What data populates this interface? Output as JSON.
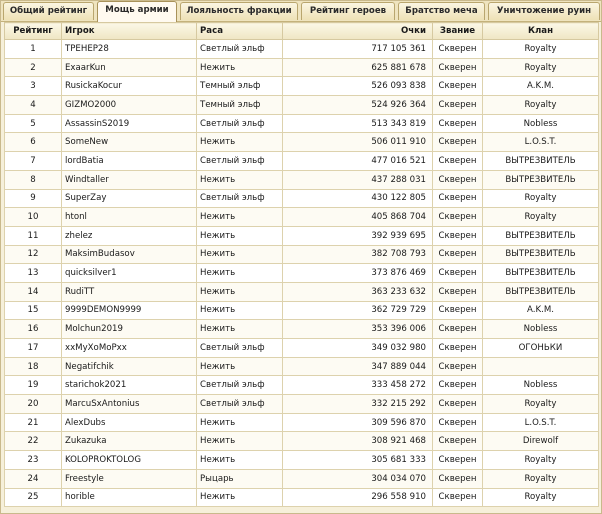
{
  "tabs": [
    {
      "label": "Общий рейтинг",
      "active": false
    },
    {
      "label": "Мощь армии",
      "active": true
    },
    {
      "label": "Лояльность фракции",
      "active": false
    },
    {
      "label": "Рейтинг героев",
      "active": false
    },
    {
      "label": "Братство меча",
      "active": false
    },
    {
      "label": "Уничтожение руин",
      "active": false
    }
  ],
  "table": {
    "headers": {
      "rank": "Рейтинг",
      "player": "Игрок",
      "race": "Раса",
      "points": "Очки",
      "title": "Звание",
      "clan": "Клан"
    },
    "rows": [
      {
        "rank": "1",
        "player": "ТРЕНЕР28",
        "race": "Светлый эльф",
        "points": "717 105 361",
        "title": "Скверен",
        "clan": "Royalty"
      },
      {
        "rank": "2",
        "player": "ExaarKun",
        "race": "Нежить",
        "points": "625 881 678",
        "title": "Скверен",
        "clan": "Royalty"
      },
      {
        "rank": "3",
        "player": "RusickaKocur",
        "race": "Темный эльф",
        "points": "526 093 838",
        "title": "Скверен",
        "clan": "A.K.M."
      },
      {
        "rank": "4",
        "player": "GIZMO2000",
        "race": "Темный эльф",
        "points": "524 926 364",
        "title": "Скверен",
        "clan": "Royalty"
      },
      {
        "rank": "5",
        "player": "AssassinS2019",
        "race": "Светлый эльф",
        "points": "513 343 819",
        "title": "Скверен",
        "clan": "Nobless"
      },
      {
        "rank": "6",
        "player": "SomeNew",
        "race": "Нежить",
        "points": "506 011 910",
        "title": "Скверен",
        "clan": "L.O.S.T."
      },
      {
        "rank": "7",
        "player": "lordBatia",
        "race": "Светлый эльф",
        "points": "477 016 521",
        "title": "Скверен",
        "clan": "ВЫТРЕЗВИТЕЛЬ"
      },
      {
        "rank": "8",
        "player": "Windtaller",
        "race": "Нежить",
        "points": "437 288 031",
        "title": "Скверен",
        "clan": "ВЫТРЕЗВИТЕЛЬ"
      },
      {
        "rank": "9",
        "player": "SuperZay",
        "race": "Светлый эльф",
        "points": "430 122 805",
        "title": "Скверен",
        "clan": "Royalty"
      },
      {
        "rank": "10",
        "player": "htonl",
        "race": "Нежить",
        "points": "405 868 704",
        "title": "Скверен",
        "clan": "Royalty"
      },
      {
        "rank": "11",
        "player": "zhelez",
        "race": "Нежить",
        "points": "392 939 695",
        "title": "Скверен",
        "clan": "ВЫТРЕЗВИТЕЛЬ"
      },
      {
        "rank": "12",
        "player": "MaksimBudasov",
        "race": "Нежить",
        "points": "382 708 793",
        "title": "Скверен",
        "clan": "ВЫТРЕЗВИТЕЛЬ"
      },
      {
        "rank": "13",
        "player": "quicksilver1",
        "race": "Нежить",
        "points": "373 876 469",
        "title": "Скверен",
        "clan": "ВЫТРЕЗВИТЕЛЬ"
      },
      {
        "rank": "14",
        "player": "RudiTT",
        "race": "Нежить",
        "points": "363 233 632",
        "title": "Скверен",
        "clan": "ВЫТРЕЗВИТЕЛЬ"
      },
      {
        "rank": "15",
        "player": "9999DEMON9999",
        "race": "Нежить",
        "points": "362 729 729",
        "title": "Скверен",
        "clan": "A.K.M."
      },
      {
        "rank": "16",
        "player": "Molchun2019",
        "race": "Нежить",
        "points": "353 396 006",
        "title": "Скверен",
        "clan": "Nobless"
      },
      {
        "rank": "17",
        "player": "xxMyXoMoPxx",
        "race": "Светлый эльф",
        "points": "349 032 980",
        "title": "Скверен",
        "clan": "ОГОНЬКИ"
      },
      {
        "rank": "18",
        "player": "Negatifchik",
        "race": "Нежить",
        "points": "347 889 044",
        "title": "Скверен",
        "clan": ""
      },
      {
        "rank": "19",
        "player": "starichok2021",
        "race": "Светлый эльф",
        "points": "333 458 272",
        "title": "Скверен",
        "clan": "Nobless"
      },
      {
        "rank": "20",
        "player": "MarcuSxAntonius",
        "race": "Светлый эльф",
        "points": "332 215 292",
        "title": "Скверен",
        "clan": "Royalty"
      },
      {
        "rank": "21",
        "player": "AlexDubs",
        "race": "Нежить",
        "points": "309 596 870",
        "title": "Скверен",
        "clan": "L.O.S.T."
      },
      {
        "rank": "22",
        "player": "Zukazuka",
        "race": "Нежить",
        "points": "308 921 468",
        "title": "Скверен",
        "clan": "Direwolf"
      },
      {
        "rank": "23",
        "player": "KOLOPROKTOLOG",
        "race": "Нежить",
        "points": "305 681 333",
        "title": "Скверен",
        "clan": "Royalty"
      },
      {
        "rank": "24",
        "player": "Freestyle",
        "race": "Рыцарь",
        "points": "304 034 070",
        "title": "Скверен",
        "clan": "Royalty"
      },
      {
        "rank": "25",
        "player": "horible",
        "race": "Нежить",
        "points": "296 558 910",
        "title": "Скверен",
        "clan": "Royalty"
      }
    ]
  }
}
